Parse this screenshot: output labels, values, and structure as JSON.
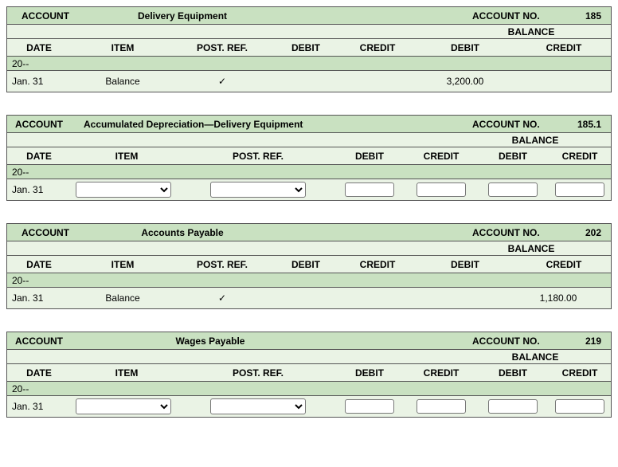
{
  "labels": {
    "account": "ACCOUNT",
    "account_no": "ACCOUNT NO.",
    "balance": "BALANCE",
    "date": "DATE",
    "item": "ITEM",
    "post_ref": "POST. REF.",
    "debit": "DEBIT",
    "credit": "CREDIT"
  },
  "ledgers": [
    {
      "mode": "static",
      "account_name": "Delivery Equipment",
      "account_no": "185",
      "year": "20--",
      "row": {
        "date": "Jan. 31",
        "item": "Balance",
        "post_ref": "✓",
        "debit": "",
        "credit": "",
        "bal_debit": "3,200.00",
        "bal_credit": ""
      }
    },
    {
      "mode": "input",
      "account_name": "Accumulated Depreciation—Delivery Equipment",
      "account_no": "185.1",
      "year": "20--",
      "row": {
        "date": "Jan. 31",
        "item": "",
        "post_ref": "",
        "debit": "",
        "credit": "",
        "bal_debit": "",
        "bal_credit": ""
      }
    },
    {
      "mode": "static",
      "account_name": "Accounts Payable",
      "account_no": "202",
      "year": "20--",
      "row": {
        "date": "Jan. 31",
        "item": "Balance",
        "post_ref": "✓",
        "debit": "",
        "credit": "",
        "bal_debit": "",
        "bal_credit": "1,180.00"
      }
    },
    {
      "mode": "input",
      "account_name": "Wages Payable",
      "account_no": "219",
      "year": "20--",
      "row": {
        "date": "Jan. 31",
        "item": "",
        "post_ref": "",
        "debit": "",
        "credit": "",
        "bal_debit": "",
        "bal_credit": ""
      }
    }
  ]
}
